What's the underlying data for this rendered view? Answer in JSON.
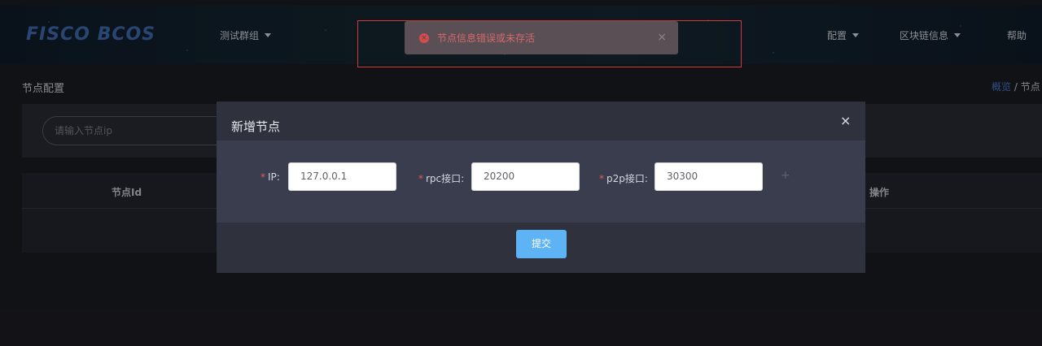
{
  "header": {
    "logo_text": "FISCO BCOS",
    "group_selector": "测试群组",
    "config_menu": "配置",
    "chain_info_menu": "区块链信息",
    "help": "帮助"
  },
  "toast": {
    "message": "节点信息错误或未存活",
    "close_symbol": "×",
    "icon_symbol": "×"
  },
  "page": {
    "title": "节点配置",
    "breadcrumb_link": "概览",
    "breadcrumb_sep": " / ",
    "breadcrumb_current": "节点"
  },
  "search": {
    "placeholder": "请输入节点ip"
  },
  "table": {
    "columns": [
      "节点Id",
      "操作"
    ]
  },
  "dialog": {
    "title": "新增节点",
    "close_symbol": "×",
    "fields": [
      {
        "label": "IP:",
        "value": "127.0.0.1"
      },
      {
        "label": "rpc接口:",
        "value": "20200"
      },
      {
        "label": "p2p接口:",
        "value": "30300"
      }
    ],
    "required_mark": "*",
    "add_symbol": "+",
    "submit_label": "提交"
  },
  "colors": {
    "accent": "#5eb3f5",
    "error": "#d94a4a",
    "link": "#4a7bd0"
  }
}
